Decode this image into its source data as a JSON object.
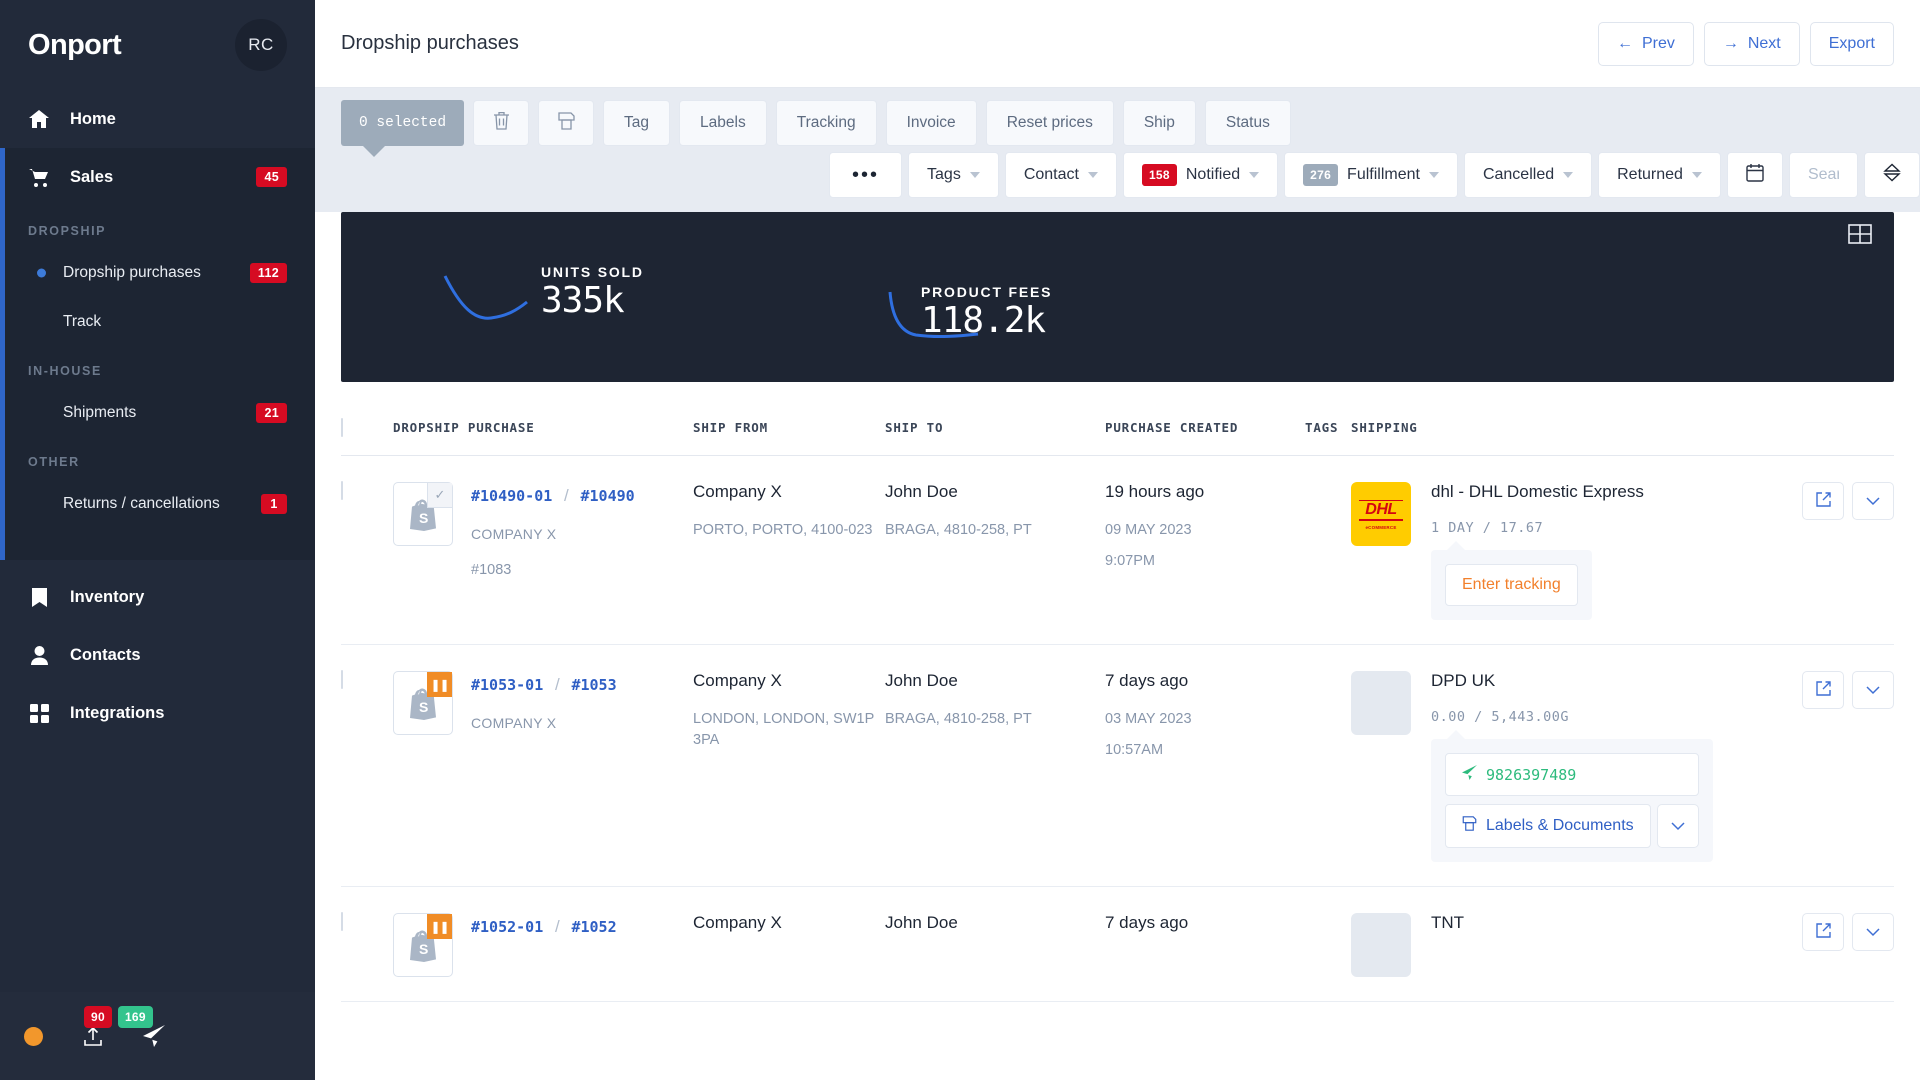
{
  "sidebar": {
    "logo": "Onport",
    "avatar": "RC",
    "home": {
      "label": "Home",
      "icon": "home-icon"
    },
    "sales": {
      "label": "Sales",
      "badge": "45",
      "icon": "cart-icon"
    },
    "groups": [
      {
        "label": "DROPSHIP",
        "items": [
          {
            "label": "Dropship purchases",
            "badge": "112",
            "active": true
          },
          {
            "label": "Track",
            "badge": ""
          }
        ]
      },
      {
        "label": "IN-HOUSE",
        "items": [
          {
            "label": "Shipments",
            "badge": "21"
          }
        ]
      },
      {
        "label": "OTHER",
        "items": [
          {
            "label": "Returns / cancellations",
            "badge": "1"
          }
        ]
      }
    ],
    "lower": [
      {
        "label": "Inventory",
        "icon": "bookmark-icon"
      },
      {
        "label": "Contacts",
        "icon": "person-icon"
      },
      {
        "label": "Integrations",
        "icon": "grid-icon"
      }
    ],
    "footer": {
      "badge_red": "90",
      "badge_green": "169",
      "status_icon": "orange-status-dot",
      "upload_icon": "upload-icon",
      "rocket_icon": "rocket-icon"
    }
  },
  "header": {
    "title": "Dropship purchases",
    "prev": "Prev",
    "next": "Next",
    "export": "Export"
  },
  "toolbar": {
    "selected": "0 selected",
    "delete_icon": "trash-icon",
    "print_icon": "print-icon",
    "buttons": [
      "Tag",
      "Labels",
      "Tracking",
      "Invoice",
      "Reset prices",
      "Ship",
      "Status"
    ],
    "filters": [
      {
        "label": "",
        "dots": true
      },
      {
        "label": "Tags",
        "count": "",
        "count_style": ""
      },
      {
        "label": "Contact",
        "count": "",
        "count_style": ""
      },
      {
        "label": "Notified",
        "count": "158",
        "count_style": "red"
      },
      {
        "label": "Fulfillment",
        "count": "276",
        "count_style": "gray"
      },
      {
        "label": "Cancelled",
        "count": "",
        "count_style": ""
      },
      {
        "label": "Returned",
        "count": "",
        "count_style": ""
      }
    ],
    "calendar_icon": "calendar-icon",
    "search_placeholder": "Search",
    "search_value": "",
    "sort_icon": "sort-icon"
  },
  "stats": {
    "grid_icon": "grid-view-icon",
    "items": [
      {
        "caption": "UNITS SOLD",
        "value": "335k",
        "spark": "curve-down-up"
      },
      {
        "caption": "PRODUCT FEES",
        "value": "118.2k",
        "spark": "curve-drop-flat"
      }
    ]
  },
  "table": {
    "columns": [
      "DROPSHIP PURCHASE",
      "SHIP FROM",
      "SHIP TO",
      "PURCHASE CREATED",
      "TAGS",
      "SHIPPING"
    ],
    "rows": [
      {
        "thumb_flag": "check",
        "id_primary": "#10490-01",
        "id_secondary": "#10490",
        "company": "COMPANY X",
        "ref": "#1083",
        "ship_from": "Company X",
        "ship_from_addr": "PORTO, PORTO, 4100-023",
        "ship_to": "John Doe",
        "ship_to_addr": "BRAGA, 4810-258, PT",
        "created": "19 hours ago",
        "created_date": "09 MAY 2023",
        "created_time": "9:07PM",
        "carrier_logo": "dhl",
        "carrier_name": "dhl - DHL Domestic Express",
        "carrier_meta": "1 DAY  /  17.67",
        "tip": [
          {
            "label": "Enter tracking",
            "style": "orange"
          }
        ]
      },
      {
        "thumb_flag": "pause",
        "id_primary": "#1053-01",
        "id_secondary": "#1053",
        "company": "COMPANY X",
        "ref": "",
        "ship_from": "Company X",
        "ship_from_addr": "LONDON, LONDON, SW1P 3PA",
        "ship_to": "John Doe",
        "ship_to_addr": "BRAGA, 4810-258, PT",
        "created": "7 days ago",
        "created_date": "03 MAY 2023",
        "created_time": "10:57AM",
        "carrier_logo": "blank",
        "carrier_name": "DPD UK",
        "carrier_meta": "0.00  /  5,443.00G",
        "tip": [
          {
            "label": "9826397489",
            "style": "green",
            "icon": "rocket-icon"
          },
          {
            "label": "Labels & Documents",
            "style": "blue",
            "icon": "print-icon",
            "has_caret": true
          }
        ]
      },
      {
        "thumb_flag": "pause",
        "id_primary": "#1052-01",
        "id_secondary": "#1052",
        "company": "",
        "ref": "",
        "ship_from": "Company X",
        "ship_from_addr": "",
        "ship_to": "John Doe",
        "ship_to_addr": "",
        "created": "7 days ago",
        "created_date": "",
        "created_time": "",
        "carrier_logo": "blank",
        "carrier_name": "TNT",
        "carrier_meta": "",
        "tip": []
      }
    ]
  },
  "colors": {
    "sidebar_bg": "#222a3a",
    "accent_blue": "#2f5fc4",
    "badge_red": "#d60b22",
    "badge_green": "#33c48d",
    "stats_bg": "#1e2533",
    "dhl_yellow": "#ffcc00",
    "orange": "#f08c26"
  }
}
